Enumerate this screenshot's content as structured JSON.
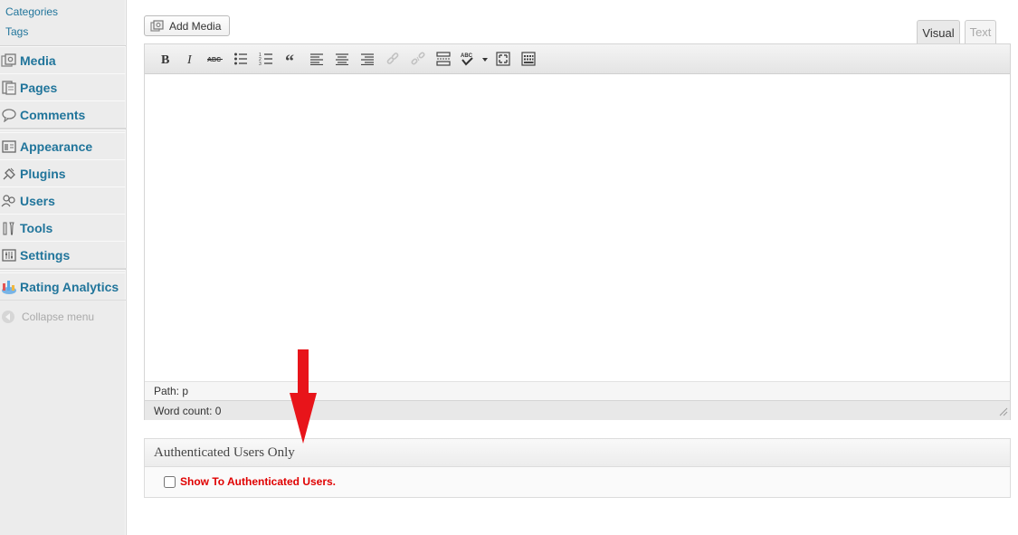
{
  "sidebar": {
    "sub_items": [
      {
        "label": "Categories"
      },
      {
        "label": "Tags"
      }
    ],
    "items": [
      {
        "label": "Media",
        "icon": "media-icon"
      },
      {
        "label": "Pages",
        "icon": "pages-icon"
      },
      {
        "label": "Comments",
        "icon": "comments-icon"
      },
      {
        "label": "Appearance",
        "icon": "appearance-icon"
      },
      {
        "label": "Plugins",
        "icon": "plugins-icon"
      },
      {
        "label": "Users",
        "icon": "users-icon"
      },
      {
        "label": "Tools",
        "icon": "tools-icon"
      },
      {
        "label": "Settings",
        "icon": "settings-icon"
      },
      {
        "label": "Rating Analytics",
        "icon": "rating-analytics-icon"
      }
    ],
    "collapse_label": "Collapse menu"
  },
  "editor": {
    "add_media_label": "Add Media",
    "tabs": [
      {
        "label": "Visual",
        "active": true
      },
      {
        "label": "Text",
        "active": false
      }
    ],
    "toolbar_buttons": [
      "bold",
      "italic",
      "strikethrough",
      "bullet-list",
      "numbered-list",
      "blockquote",
      "align-left",
      "align-center",
      "align-right",
      "insert-link",
      "remove-link",
      "insert-more",
      "spellcheck",
      "fullscreen",
      "toolbar-toggle"
    ],
    "path_text": "Path: p",
    "word_count_text": "Word count: 0"
  },
  "meta_box": {
    "title": "Authenticated Users Only",
    "checkbox_label": "Show To Authenticated Users.",
    "checked": false
  },
  "colors": {
    "link": "#21759b",
    "accent_red": "#e00000",
    "arrow_red": "#e8141a"
  }
}
